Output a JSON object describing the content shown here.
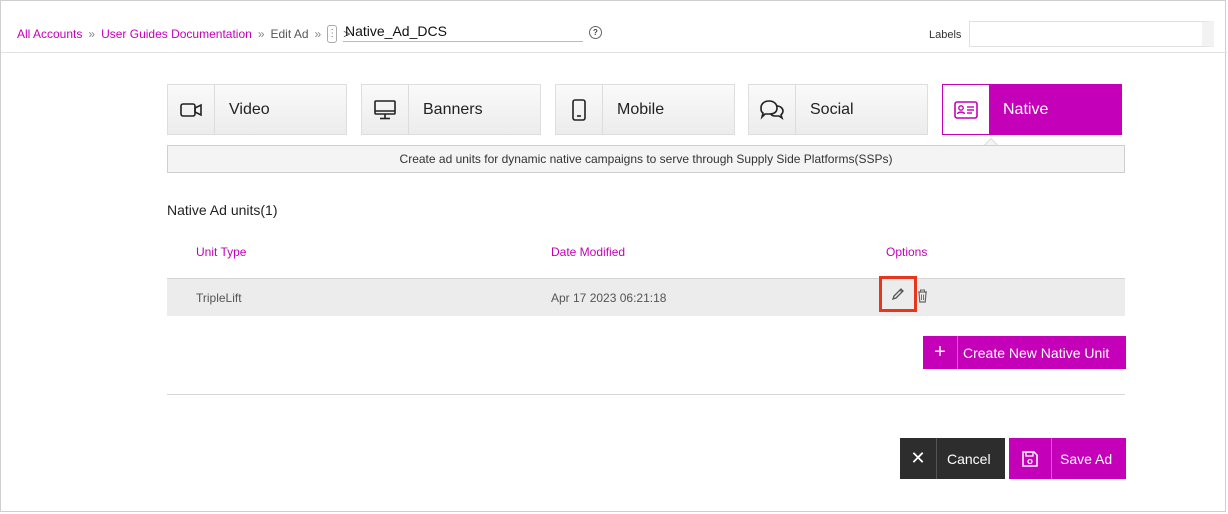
{
  "breadcrumb": {
    "items": [
      "All Accounts",
      "User Guides Documentation",
      "Edit Ad"
    ],
    "separator": "»",
    "arrow": ">"
  },
  "ad": {
    "name": "Native_Ad_DCS"
  },
  "labels": {
    "label": "Labels",
    "value": ""
  },
  "tabs": [
    {
      "label": "Video",
      "icon": "video-camera-icon"
    },
    {
      "label": "Banners",
      "icon": "monitor-icon"
    },
    {
      "label": "Mobile",
      "icon": "mobile-phone-icon"
    },
    {
      "label": "Social",
      "icon": "chat-bubbles-icon"
    },
    {
      "label": "Native",
      "icon": "id-card-icon",
      "active": true
    }
  ],
  "description": "Create ad units for dynamic native campaigns to serve through Supply Side Platforms(SSPs)",
  "units": {
    "title": "Native Ad units(1)",
    "columns": [
      "Unit Type",
      "Date Modified",
      "Options"
    ],
    "rows": [
      {
        "unit_type": "TripleLift",
        "date_modified": "Apr 17 2023 06:21:18"
      }
    ]
  },
  "actions": {
    "create": "Create New Native Unit",
    "cancel": "Cancel",
    "save": "Save Ad"
  },
  "colors": {
    "accent": "#c400b8",
    "dark": "#2d2d2d",
    "highlight": "#e8361d"
  }
}
